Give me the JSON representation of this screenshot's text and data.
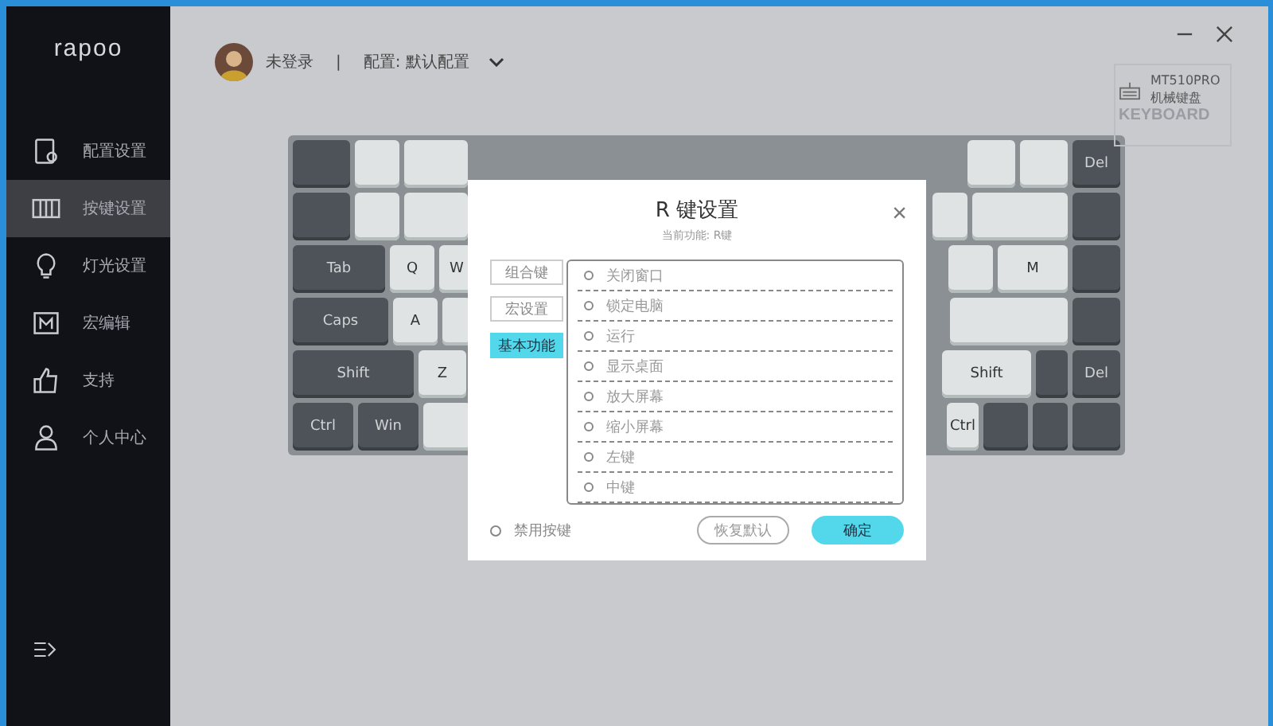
{
  "sidebar": {
    "logo": "rapoo",
    "items": [
      {
        "label": "配置设置",
        "selected": false
      },
      {
        "label": "按键设置",
        "selected": true
      },
      {
        "label": "灯光设置",
        "selected": false
      },
      {
        "label": "宏编辑",
        "selected": false
      },
      {
        "label": "支持",
        "selected": false
      },
      {
        "label": "个人中心",
        "selected": false
      }
    ]
  },
  "header": {
    "user": "未登录",
    "separator": "|",
    "profile": "配置: 默认配置"
  },
  "device": {
    "model": "MT510PRO",
    "type": "机械键盘",
    "watermark": "KEYBOARD"
  },
  "keyboard": {
    "rows": [
      {
        "left": [
          {
            "dark": true
          },
          {
            "dark": false
          },
          {
            "dark": false
          }
        ],
        "right": [
          {
            "dark": false
          },
          {
            "dark": false
          },
          {
            "dark": true,
            "label": "Del"
          }
        ]
      },
      {
        "left": [
          {
            "dark": true
          },
          {
            "dark": false
          },
          {
            "dark": false
          }
        ],
        "right": [
          {
            "dark": false
          },
          {
            "dark": false
          },
          {
            "dark": true
          }
        ]
      },
      {
        "left": [
          {
            "dark": true,
            "label": "Tab"
          },
          {
            "dark": false,
            "label": "Q"
          },
          {
            "dark": false,
            "label": "W"
          }
        ],
        "right": [
          {
            "dark": false
          },
          {
            "dark": false,
            "label": "M"
          },
          {
            "dark": true
          }
        ]
      },
      {
        "left": [
          {
            "dark": true,
            "label": "Caps"
          },
          {
            "dark": false,
            "label": "A"
          },
          {
            "dark": false
          }
        ],
        "right": [
          {
            "dark": false
          },
          {
            "dark": true
          }
        ]
      },
      {
        "left": [
          {
            "dark": true,
            "label": "Shift"
          },
          {
            "dark": false,
            "label": "Z"
          }
        ],
        "right": [
          {
            "dark": false,
            "label": "Shift"
          },
          {
            "dark": true
          },
          {
            "dark": true,
            "label": "Del"
          }
        ]
      },
      {
        "left": [
          {
            "dark": true,
            "label": "Ctrl"
          },
          {
            "dark": true,
            "label": "Win"
          },
          {
            "dark": false
          }
        ],
        "right": [
          {
            "dark": false,
            "label": "Ctrl"
          },
          {
            "dark": true
          },
          {
            "dark": true
          },
          {
            "dark": true
          }
        ]
      }
    ]
  },
  "dialog": {
    "title": "R 键设置",
    "subtitle": "当前功能: R键",
    "close": "×",
    "tabs": [
      {
        "label": "组合键",
        "selected": false
      },
      {
        "label": "宏设置",
        "selected": false
      },
      {
        "label": "基本功能",
        "selected": true
      }
    ],
    "options": [
      "关闭窗口",
      "锁定电脑",
      "运行",
      "显示桌面",
      "放大屏幕",
      "缩小屏幕",
      "左键",
      "中键"
    ],
    "disable": {
      "label": "禁用按键",
      "checked": false
    },
    "buttons": [
      {
        "label": "恢复默认",
        "kind": "secondary"
      },
      {
        "label": "确定",
        "kind": "primary"
      }
    ]
  }
}
